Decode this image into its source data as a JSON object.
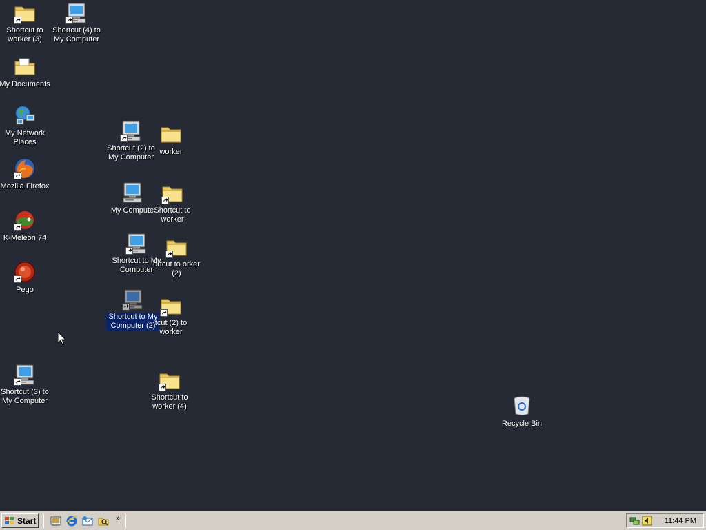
{
  "desktop": {
    "icons": [
      {
        "label": "Shortcut to worker (3)"
      },
      {
        "label": "Shortcut (4) to My Computer"
      },
      {
        "label": "My Documents"
      },
      {
        "label": "My Network Places"
      },
      {
        "label": "Mozilla Firefox"
      },
      {
        "label": "K-Meleon 74"
      },
      {
        "label": "Pego"
      },
      {
        "label": "Shortcut (3) to My Computer"
      },
      {
        "label": "Shortcut (2) to My Computer"
      },
      {
        "label": "worker"
      },
      {
        "label": "My Compute"
      },
      {
        "label": "Shortcut to worker"
      },
      {
        "label": "Shortcut to My Computer"
      },
      {
        "label": "ortcut to orker (2)"
      },
      {
        "label": "Shortcut to My Computer (2)"
      },
      {
        "label": "tcut (2) to worker"
      },
      {
        "label": "Shortcut to worker (4)"
      },
      {
        "label": "Recycle Bin"
      }
    ],
    "selected_color": "#0a246a"
  },
  "taskbar": {
    "start_label": "Start",
    "quick_launch": [
      "show-desktop-icon",
      "internet-explorer-icon",
      "outlook-express-icon",
      "explorer-icon"
    ],
    "more_label": "»",
    "clock": "11:44 PM"
  }
}
